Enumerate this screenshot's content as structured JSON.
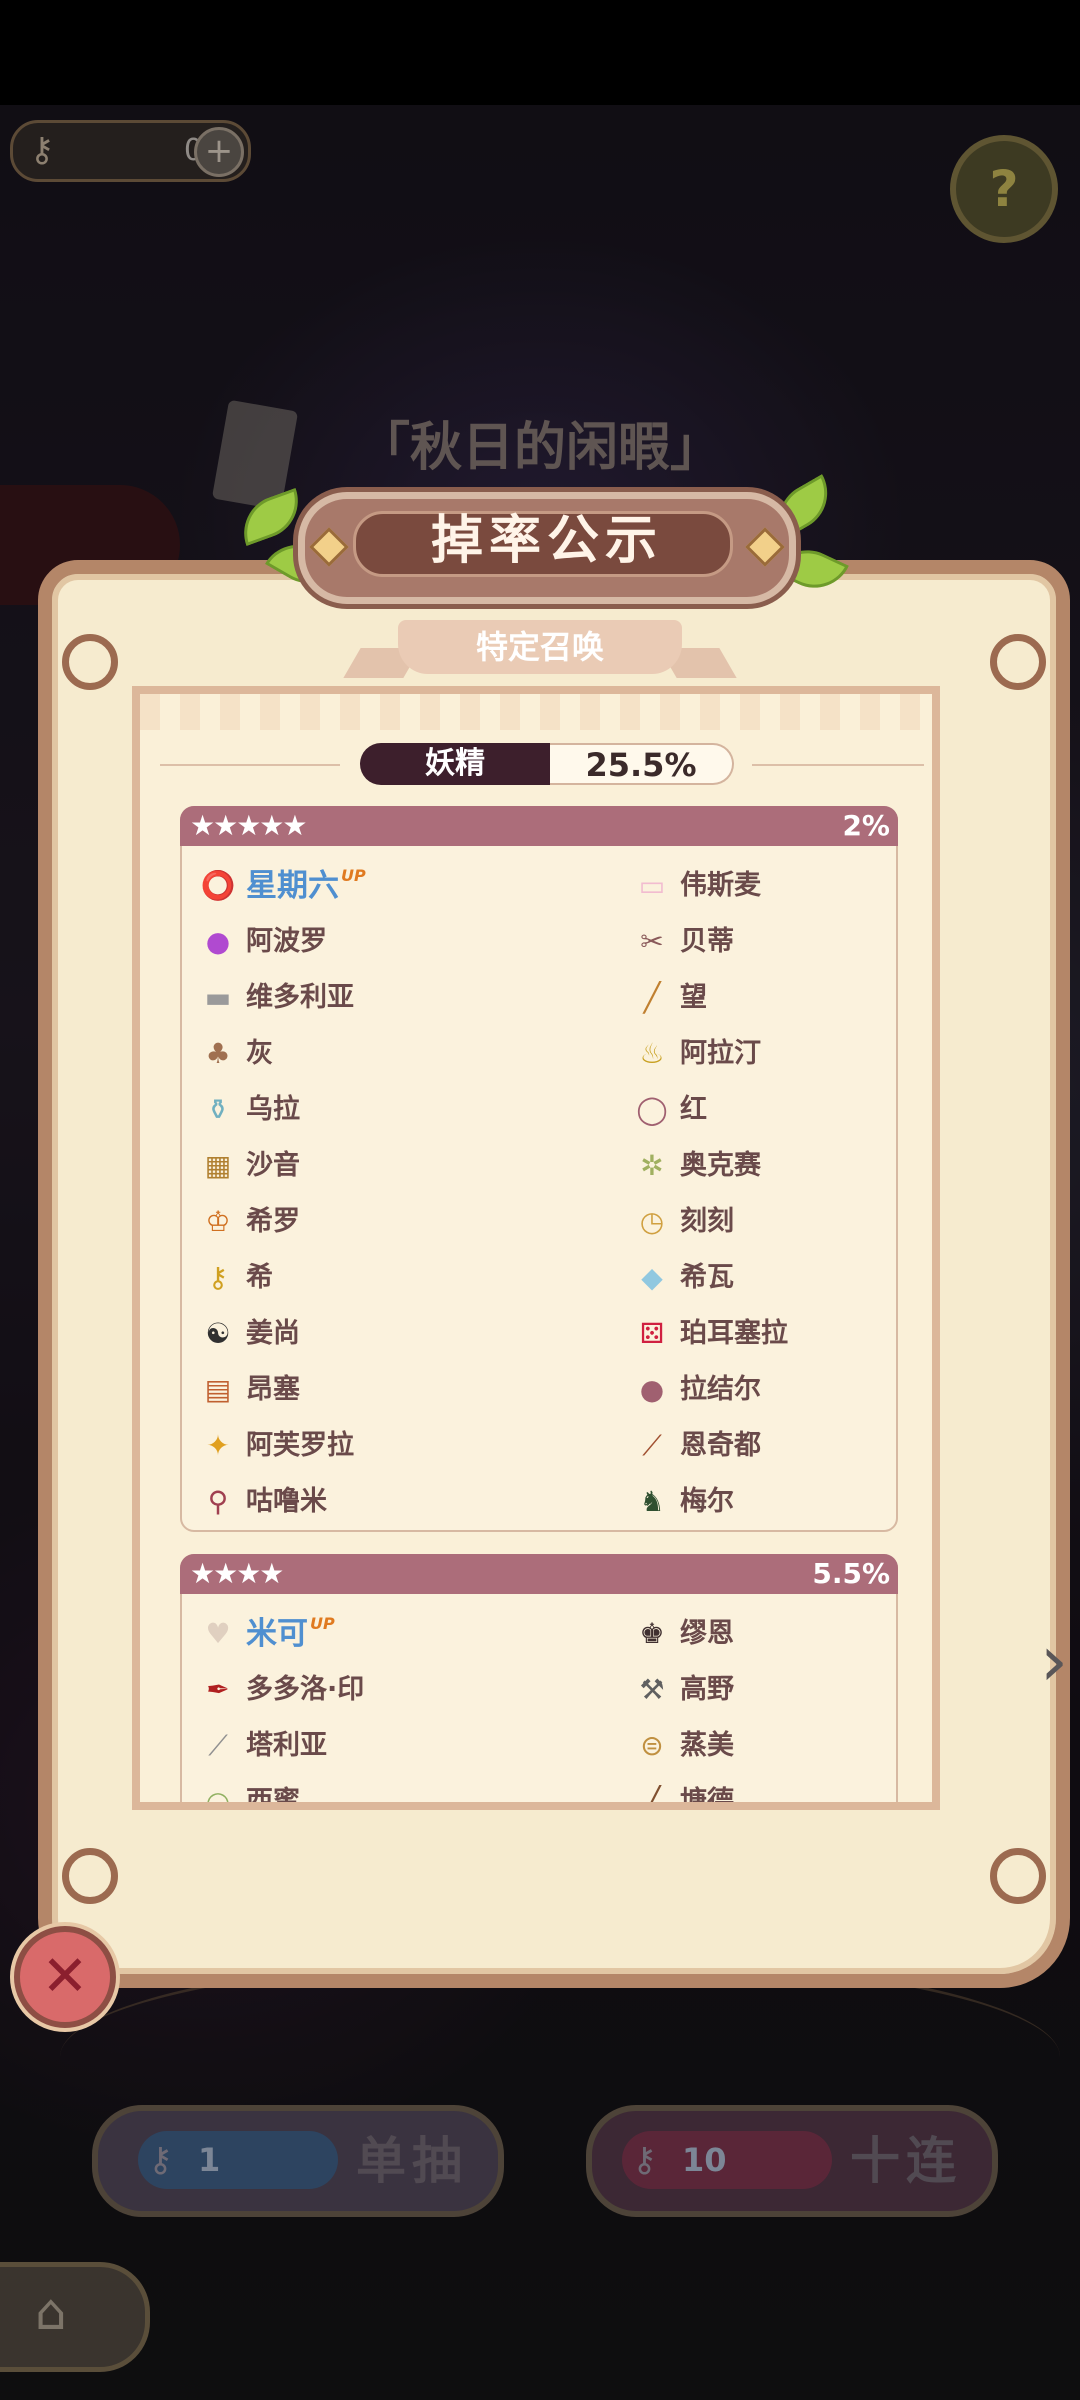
{
  "top": {
    "key_count": "0",
    "plus": "+",
    "help": "?",
    "key_icon": "key-icon"
  },
  "pool_name": "「秋日的闲暇」",
  "dialog": {
    "title": "掉率公示",
    "subtitle": "特定召唤",
    "tab_label": "妖精",
    "tab_rate": "25.5%"
  },
  "groups": [
    {
      "stars": "★★★★★",
      "rate": "2%",
      "items": [
        {
          "name": "星期六",
          "up": "UP",
          "icon": "⭕",
          "color": "#e0505a"
        },
        {
          "name": "伟斯麦",
          "icon": "▭",
          "color": "#f2bcd0"
        },
        {
          "name": "阿波罗",
          "icon": "●",
          "color": "#b04ad0"
        },
        {
          "name": "贝蒂",
          "icon": "✂",
          "color": "#8a5a5a"
        },
        {
          "name": "维多利亚",
          "icon": "▬",
          "color": "#9a9a9a"
        },
        {
          "name": "望",
          "icon": "╱",
          "color": "#c08030"
        },
        {
          "name": "灰",
          "icon": "♣",
          "color": "#a07050"
        },
        {
          "name": "阿拉汀",
          "icon": "♨",
          "color": "#c8a020"
        },
        {
          "name": "乌拉",
          "icon": "⚱",
          "color": "#70b0c0"
        },
        {
          "name": "红",
          "icon": "◯",
          "color": "#a06070"
        },
        {
          "name": "沙音",
          "icon": "▦",
          "color": "#b08030"
        },
        {
          "name": "奥克赛",
          "icon": "✲",
          "color": "#a0b060"
        },
        {
          "name": "希罗",
          "icon": "♔",
          "color": "#d07020"
        },
        {
          "name": "刻刻",
          "icon": "◷",
          "color": "#d0a040"
        },
        {
          "name": "希",
          "icon": "⚷",
          "color": "#d0a020"
        },
        {
          "name": "希瓦",
          "icon": "◆",
          "color": "#90c8e0"
        },
        {
          "name": "姜尚",
          "icon": "☯",
          "color": "#303030"
        },
        {
          "name": "珀耳塞拉",
          "icon": "⚄",
          "color": "#d02040"
        },
        {
          "name": "昂塞",
          "icon": "▤",
          "color": "#c06030"
        },
        {
          "name": "拉结尔",
          "icon": "●",
          "color": "#a06070"
        },
        {
          "name": "阿芙罗拉",
          "icon": "✦",
          "color": "#e0a020"
        },
        {
          "name": "恩奇都",
          "icon": "⟋",
          "color": "#a05030"
        },
        {
          "name": "咕噜米",
          "icon": "⚲",
          "color": "#a04050"
        },
        {
          "name": "梅尔",
          "icon": "♞",
          "color": "#305030"
        }
      ]
    },
    {
      "stars": "★★★★",
      "rate": "5.5%",
      "items": [
        {
          "name": "米可",
          "up": "UP",
          "icon": "♥",
          "color": "#e0d0c0"
        },
        {
          "name": "缪恩",
          "icon": "♚",
          "color": "#403030"
        },
        {
          "name": "多多洛·印",
          "icon": "✒",
          "color": "#b02020"
        },
        {
          "name": "高野",
          "icon": "⚒",
          "color": "#606060"
        },
        {
          "name": "塔利亚",
          "icon": "⟋",
          "color": "#909090"
        },
        {
          "name": "蒸美",
          "icon": "⊜",
          "color": "#c09040"
        },
        {
          "name": "西蜜",
          "icon": "◒",
          "color": "#90b060"
        },
        {
          "name": "塘德",
          "icon": "╱",
          "color": "#805030"
        }
      ]
    }
  ],
  "buttons": {
    "close": "✕",
    "single_count": "1",
    "single_label": "单抽",
    "ten_count": "10",
    "ten_label": "十连",
    "home": "⌂",
    "chevron": "›"
  }
}
